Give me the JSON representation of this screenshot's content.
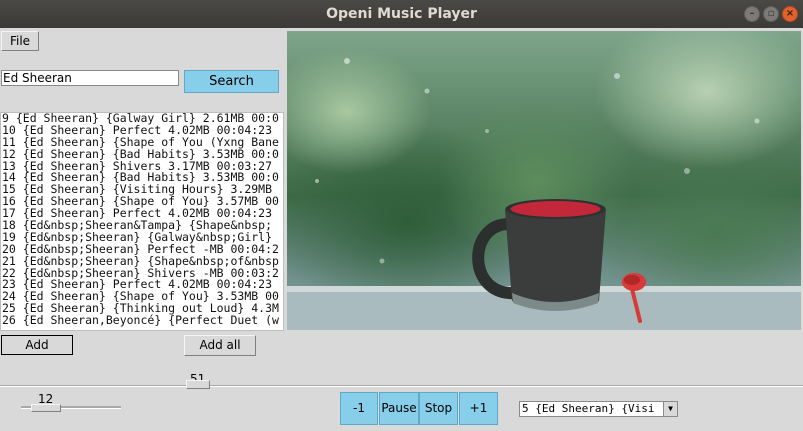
{
  "window": {
    "title": "Openi Music Player"
  },
  "menu": {
    "file_label": "File"
  },
  "search": {
    "value": "Ed Sheeran",
    "button_label": "Search"
  },
  "playlist": [
    "9 {Ed Sheeran} {Galway Girl} 2.61MB 00:0",
    "10 {Ed Sheeran} Perfect 4.02MB 00:04:23",
    "11 {Ed Sheeran} {Shape of You (Yxng Bane",
    "12 {Ed Sheeran} {Bad Habits} 3.53MB 00:0",
    "13 {Ed Sheeran} Shivers 3.17MB 00:03:27",
    "14 {Ed Sheeran} {Bad Habits} 3.53MB 00:0",
    "15 {Ed Sheeran} {Visiting Hours} 3.29MB",
    "16 {Ed Sheeran} {Shape of You} 3.57MB 00",
    "17 {Ed Sheeran} Perfect 4.02MB 00:04:23",
    "18 {Ed&nbsp;Sheeran&Tampa} {Shape&nbsp;",
    "19 {Ed&nbsp;Sheeran} {Galway&nbsp;Girl}",
    "20 {Ed&nbsp;Sheeran} Perfect -MB 00:04:2",
    "21 {Ed&nbsp;Sheeran} {Shape&nbsp;of&nbsp",
    "22 {Ed&nbsp;Sheeran} Shivers -MB 00:03:2",
    "23 {Ed Sheeran} Perfect 4.02MB 00:04:23",
    "24 {Ed Sheeran} {Shape of You} 3.53MB 00",
    "25 {Ed Sheeran} {Thinking out Loud} 4.3M",
    "26 {Ed Sheeran,Beyoncé} {Perfect Duet (w"
  ],
  "actions": {
    "add_label": "Add",
    "add_all_label": "Add all"
  },
  "progress": {
    "value_label": "51",
    "value": 51
  },
  "volume": {
    "value_label": "12",
    "value": 12
  },
  "controls": {
    "prev": "-1",
    "pause": "Pause",
    "stop": "Stop",
    "next": "+1"
  },
  "now_playing": {
    "selected": "5 {Ed Sheeran} {Visi"
  },
  "colors": {
    "accent": "#87ceeb",
    "titlebar": "#3c3b37",
    "window_bg": "#d9d9d9"
  }
}
